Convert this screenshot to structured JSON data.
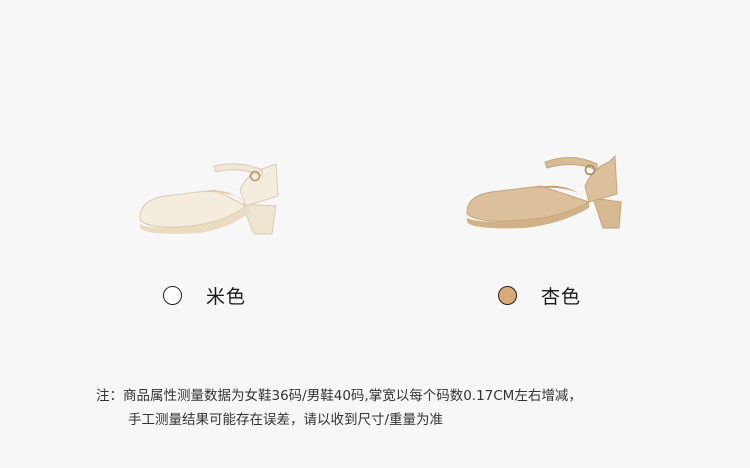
{
  "variants": [
    {
      "label": "米色",
      "swatch_color": "#ffffff",
      "shoe_color": "#f3ead8"
    },
    {
      "label": "杏色",
      "swatch_color": "#d9a97a",
      "shoe_color": "#dcc09b"
    }
  ],
  "note": {
    "line1": "注：商品属性测量数据为女鞋36码/男鞋40码,掌宽以每个码数0.17CM左右增减，",
    "line2": "手工测量结果可能存在误差，请以收到尺寸/重量为准"
  }
}
